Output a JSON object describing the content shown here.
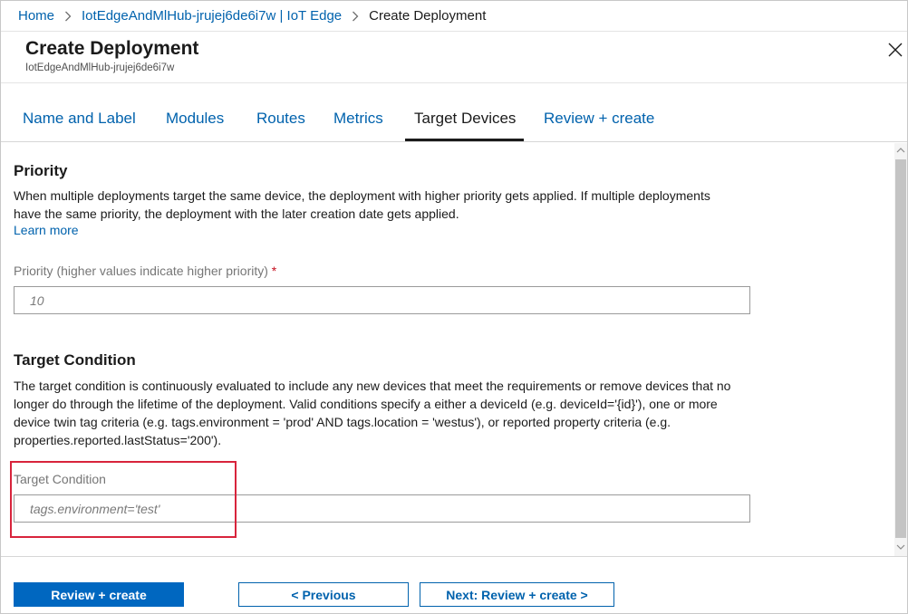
{
  "breadcrumb": {
    "items": [
      "Home",
      "IotEdgeAndMlHub-jrujej6de6i7w | IoT Edge"
    ],
    "current": "Create Deployment"
  },
  "header": {
    "title": "Create Deployment",
    "subtitle": "IotEdgeAndMlHub-jrujej6de6i7w"
  },
  "tabs": [
    {
      "label": "Name and Label",
      "active": false
    },
    {
      "label": "Modules",
      "active": false
    },
    {
      "label": "Routes",
      "active": false
    },
    {
      "label": "Metrics",
      "active": false
    },
    {
      "label": "Target Devices",
      "active": true
    },
    {
      "label": "Review + create",
      "active": false
    }
  ],
  "priority": {
    "title": "Priority",
    "description": "When multiple deployments target the same device, the deployment with higher priority gets applied. If multiple deployments have the same priority, the deployment with the later creation date gets applied.",
    "learn_more": "Learn more",
    "field_label": "Priority (higher values indicate higher priority)",
    "required_mark": "*",
    "placeholder": "10",
    "value": ""
  },
  "target_condition": {
    "title": "Target Condition",
    "description": "The target condition is continuously evaluated to include any new devices that meet the requirements or remove devices that no longer do through the lifetime of the deployment. Valid conditions specify a either a deviceId (e.g. deviceId='{id}'), one or more device twin tag criteria (e.g. tags.environment = 'prod' AND tags.location = 'westus'), or reported property criteria (e.g. properties.reported.lastStatus='200').",
    "field_label": "Target Condition",
    "placeholder": "tags.environment='test'",
    "value": ""
  },
  "footer": {
    "review_create": "Review + create",
    "previous": "< Previous",
    "next": "Next: Review + create >"
  },
  "colors": {
    "link": "#0062ad",
    "primary_button": "#0067c0",
    "highlight": "#d8243c",
    "required": "#c50f1f"
  },
  "icons": {
    "close": "close-icon",
    "breadcrumb_separator": "chevron-right-icon",
    "scroll_up": "chevron-up-icon",
    "scroll_down": "chevron-down-icon"
  }
}
